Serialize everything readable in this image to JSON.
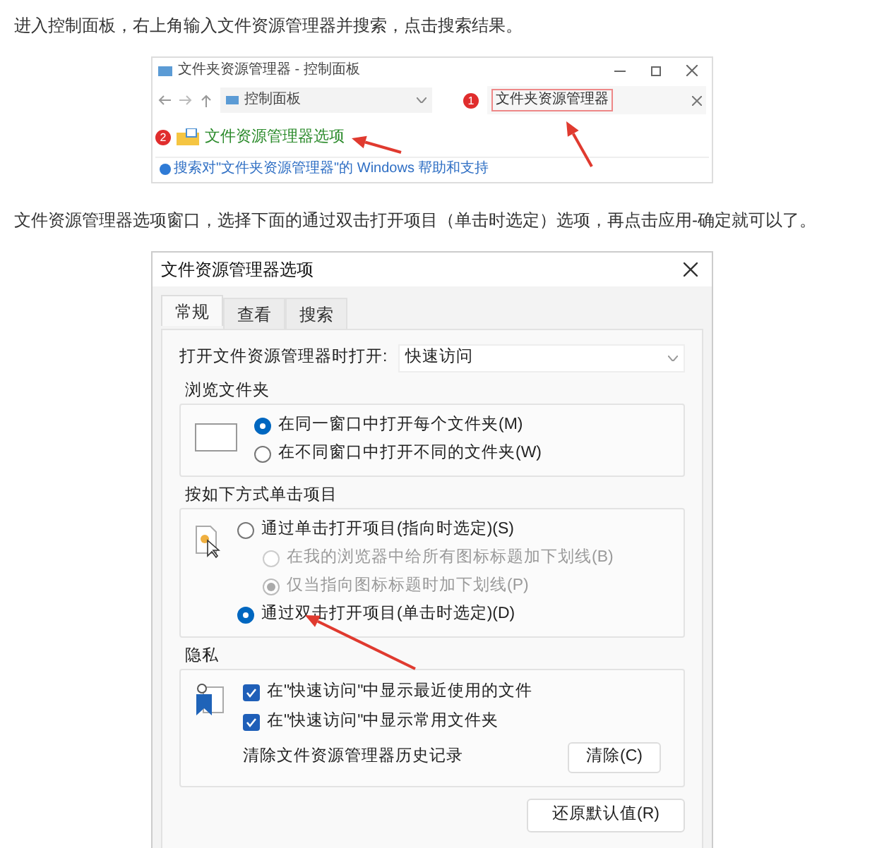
{
  "intro_1": "进入控制面板，右上角输入文件资源管理器并搜索，点击搜索结果。",
  "screenshot_1": {
    "title": "文件夹资源管理器 - 控制面板",
    "breadcrumb": "控制面板",
    "search_value": "文件夹资源管理器",
    "badges": [
      "1",
      "2"
    ],
    "result": "文件资源管理器选项",
    "help_link": "搜索对\"文件夹资源管理器\"的 Windows 帮助和支持"
  },
  "intro_2": "文件资源管理器选项窗口，选择下面的通过双击打开项目（单击时选定）选项，再点击应用-确定就可以了。",
  "dialog": {
    "title": "文件资源管理器选项",
    "tabs": [
      {
        "label": "常规",
        "selected": true
      },
      {
        "label": "查看",
        "selected": false
      },
      {
        "label": "搜索",
        "selected": false
      }
    ],
    "open_label": "打开文件资源管理器时打开:",
    "open_value": "快速访问",
    "browse_group": {
      "title": "浏览文件夹",
      "options": [
        {
          "label": "在同一窗口中打开每个文件夹(M)",
          "selected": true
        },
        {
          "label": "在不同窗口中打开不同的文件夹(W)",
          "selected": false
        }
      ]
    },
    "click_group": {
      "title": "按如下方式单击项目",
      "options": [
        {
          "label": "通过单击打开项目(指向时选定)(S)",
          "selected": false,
          "children": [
            {
              "label": "在我的浏览器中给所有图标标题加下划线(B)",
              "selected": false,
              "disabled": true
            },
            {
              "label": "仅当指向图标标题时加下划线(P)",
              "selected": true,
              "disabled": true
            }
          ]
        },
        {
          "label": "通过双击打开项目(单击时选定)(D)",
          "selected": true
        }
      ]
    },
    "privacy_group": {
      "title": "隐私",
      "checkboxes": [
        {
          "label": "在\"快速访问\"中显示最近使用的文件",
          "checked": true
        },
        {
          "label": "在\"快速访问\"中显示常用文件夹",
          "checked": true
        }
      ],
      "clear_label": "清除文件资源管理器历史记录",
      "clear_button": "清除(C)"
    },
    "restore_button": "还原默认值(R)"
  }
}
